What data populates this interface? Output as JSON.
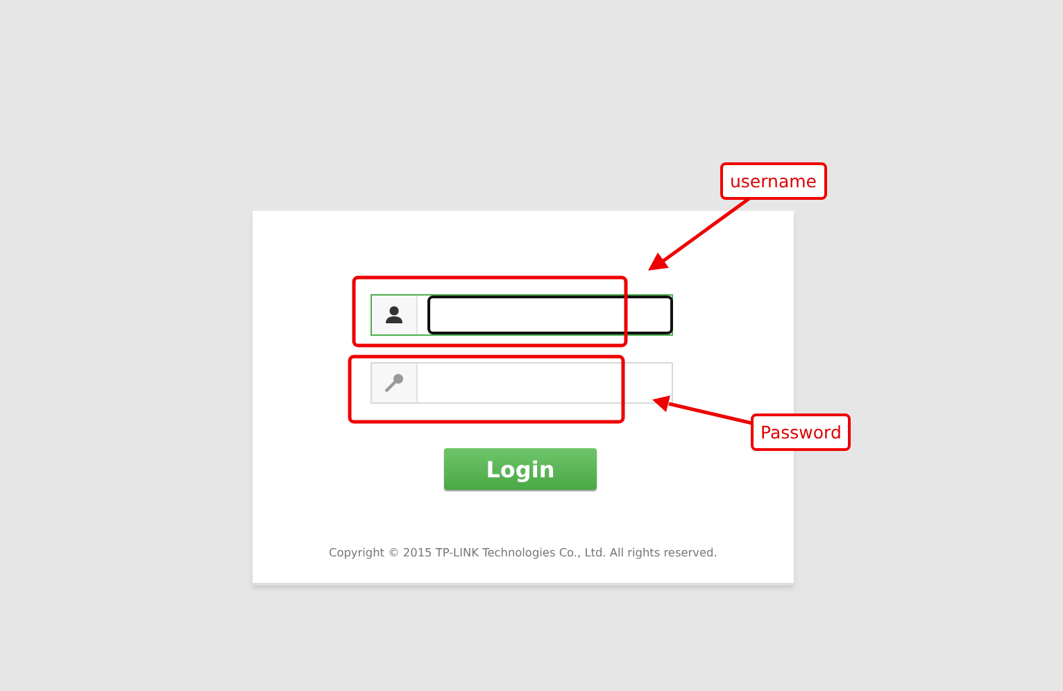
{
  "login_form": {
    "fields": [
      {
        "kind": "user",
        "focused": true
      },
      {
        "kind": "password",
        "focused": false
      }
    ],
    "login_button": "Login",
    "copyright": "Copyright © 2015 TP-LINK Technologies Co., Ltd. All rights reserved."
  },
  "annotations": [
    {
      "label": "username"
    },
    {
      "label": "Password"
    }
  ]
}
